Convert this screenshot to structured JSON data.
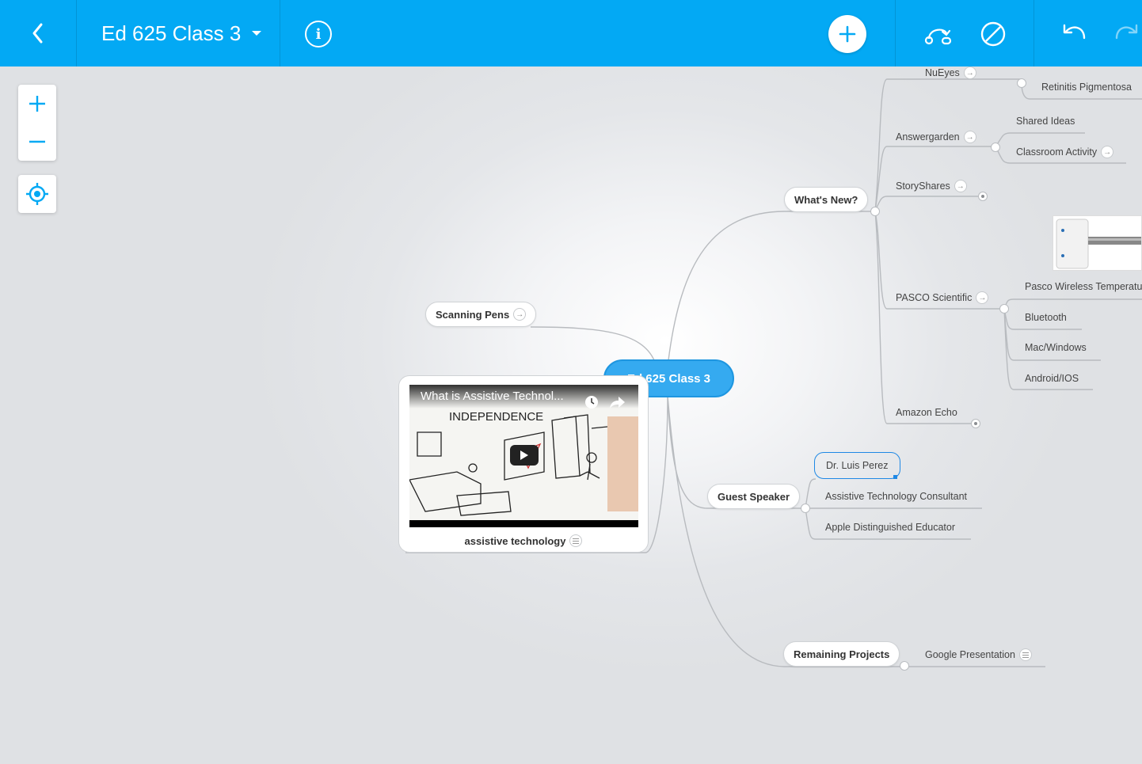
{
  "app": {
    "title": "Ed 625 Class 3"
  },
  "toolbar": {
    "back_icon": "chevron-left-icon",
    "info_label": "i",
    "add_icon": "plus-icon",
    "connect_icon": "connector-icon",
    "disable_icon": "no-entry-icon",
    "undo_icon": "undo-icon",
    "redo_icon": "redo-icon",
    "accent": "#03a9f4"
  },
  "map": {
    "root": "Ed 625 Class 3",
    "scanning_pens": "Scanning Pens",
    "video_title": "What is Assistive Technol...",
    "video_caption": "assistive technology",
    "whats_new": {
      "label": "What's New?",
      "nueyes": "NuEyes",
      "retinitis": "Retinitis Pigmentosa",
      "answergarden": "Answergarden",
      "shared_ideas": "Shared Ideas",
      "classroom_activity": "Classroom Activity",
      "storyshares": "StoryShares",
      "pasco": "PASCO Scientific",
      "pasco_wireless": "Pasco Wireless Temperatu",
      "bluetooth": "Bluetooth",
      "mac_windows": "Mac/Windows",
      "android_ios": "Android/IOS",
      "amazon_echo": "Amazon Echo"
    },
    "guest_speaker": {
      "label": "Guest Speaker",
      "name": "Dr. Luis Perez",
      "role1": "Assistive Technology Consultant",
      "role2": "Apple Distinguished Educator"
    },
    "remaining_projects": {
      "label": "Remaining Projects",
      "google_presentation": "Google Presentation"
    }
  },
  "zoom": {
    "in_icon": "zoom-in-icon",
    "out_icon": "zoom-out-icon",
    "center_icon": "crosshair-icon"
  },
  "colors": {
    "root_fill": "#35aaf0",
    "link": "#b5b8bc",
    "selected": "#1e88e5"
  }
}
